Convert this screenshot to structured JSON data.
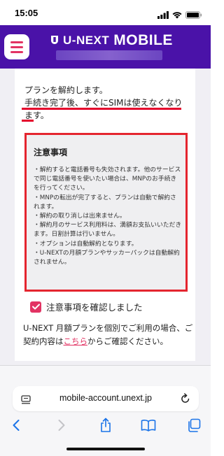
{
  "status_bar": {
    "time": "15:05"
  },
  "header": {
    "logo_text": "U-NEXT",
    "logo_mobile": "MOBILE"
  },
  "content": {
    "intro": "プランを解約します。",
    "warning": "手続き完了後、すぐにSIMは使えなくなります。",
    "notice_title": "注意事項",
    "notice_items": [
      "・解約すると電話番号も失効されます。他のサービスで同じ電話番号を使いたい場合は、MNPのお手続きを行ってください。",
      "・MNPの転出が完了すると、プランは自動で解約されます。",
      "・解約の取り消しは出来ません。",
      "・解約月のサービス利用料は、満額お支払いいただきます。日割計算は行いません。",
      "・オプションは自動解約となります。",
      "・U-NEXTの月額プランやサッカーパックは自動解約されません。"
    ],
    "confirm_label": "注意事項を確認しました",
    "confirm_checked": true,
    "usage_text_before": "U-NEXT 月額プランを個別でご利用の場合、ご契約内容は",
    "usage_link": "こちら",
    "usage_text_after": "からご確認ください。"
  },
  "browser": {
    "url": "mobile-account.unext.jp"
  },
  "colors": {
    "brand_purple": "#4a12a8",
    "accent_pink": "#e23363",
    "alert_red": "#e4252f"
  },
  "icons": [
    "cellular-icon",
    "wifi-icon",
    "battery-icon",
    "menu-icon",
    "unext-logo-icon",
    "reader-icon",
    "reload-icon",
    "back-icon",
    "forward-icon",
    "share-icon",
    "bookmarks-icon",
    "tabs-icon",
    "checkmark-icon"
  ]
}
